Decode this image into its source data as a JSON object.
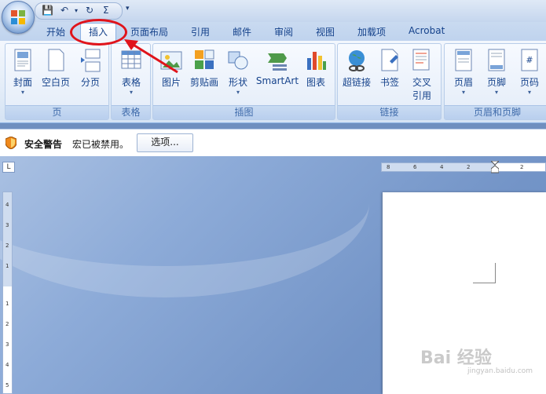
{
  "qat": {
    "save": "💾",
    "undo": "↶",
    "redo": "↻",
    "sigma": "Σ",
    "more": "▾"
  },
  "tabs": [
    "开始",
    "插入",
    "页面布局",
    "引用",
    "邮件",
    "审阅",
    "视图",
    "加载项",
    "Acrobat"
  ],
  "active_tab": "插入",
  "ribbon": {
    "groups": [
      {
        "label": "页",
        "buttons": [
          "封面",
          "空白页",
          "分页"
        ]
      },
      {
        "label": "表格",
        "buttons": [
          "表格"
        ]
      },
      {
        "label": "插图",
        "buttons": [
          "图片",
          "剪贴画",
          "形状",
          "SmartArt",
          "图表"
        ]
      },
      {
        "label": "链接",
        "buttons": [
          "超链接",
          "书签",
          "交叉引用"
        ]
      },
      {
        "label": "页眉和页脚",
        "buttons": [
          "页眉",
          "页脚",
          "页码"
        ]
      }
    ],
    "cross_ref_line1": "交叉",
    "cross_ref_line2": "引用"
  },
  "security_bar": {
    "title": "安全警告",
    "message": "宏已被禁用。",
    "options_button": "选项..."
  },
  "ruler": {
    "corner": "L",
    "h_ticks": [
      "8",
      "6",
      "4",
      "2",
      "2"
    ],
    "v_ticks": [
      "4",
      "3",
      "2",
      "1",
      "1",
      "2",
      "3",
      "4",
      "5"
    ]
  },
  "watermark": {
    "text": "Bai 经验",
    "sub": "jingyan.baidu.com"
  },
  "colors": {
    "annotation": "#e0141b",
    "ribbon_text": "#15428b",
    "doc_bg": "#7394c7"
  }
}
